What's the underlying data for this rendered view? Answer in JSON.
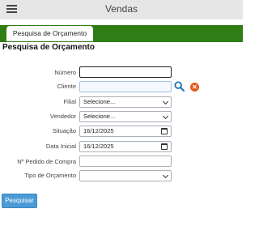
{
  "header": {
    "title": "Vendas",
    "menu_icon": "hamburger-menu-icon"
  },
  "tabs": [
    {
      "label": "Pesquisa de Orçamento",
      "active": true
    }
  ],
  "page": {
    "title": "Pesquisa de Orçamento"
  },
  "colors": {
    "tab_bar": "#2f7d15",
    "button": "#4a9ad6",
    "clear_icon": "#e65a1b",
    "search_icon": "#1e6fb5"
  },
  "form": {
    "numero": {
      "label": "Número",
      "value": ""
    },
    "cliente": {
      "label": "Cliente",
      "value": "",
      "icons": [
        "search-icon",
        "clear-icon"
      ]
    },
    "filial": {
      "label": "Filial",
      "selected": "Selecione..."
    },
    "vendedor": {
      "label": "Vendedor",
      "selected": "Selecione..."
    },
    "situacao": {
      "label": "Situação",
      "value": "16/12/2025"
    },
    "data_inicial": {
      "label": "Data Inicial",
      "value": "16/12/2025"
    },
    "pedido_compra": {
      "label": "Nº Pedido de Compra",
      "value": ""
    },
    "tipo_orcamento": {
      "label": "Tipo de Orçamento",
      "selected": ""
    }
  },
  "actions": {
    "search_label": "Pesquisar"
  }
}
